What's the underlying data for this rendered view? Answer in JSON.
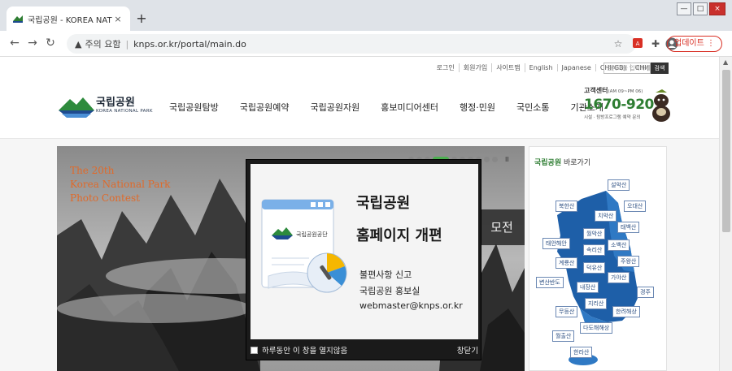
{
  "browser": {
    "tab_title": "국립공원 - KOREA NATIONAL P...",
    "tab_close": "×",
    "new_tab": "+",
    "window_controls": [
      "—",
      "□",
      "×"
    ],
    "security_label": "주의 요함",
    "url": "knps.or.kr/portal/main.do",
    "update_button": "업데이트 ⋮",
    "colors": {
      "tabstrip": "#dfe3e8",
      "update": "#d93025"
    }
  },
  "header": {
    "utility_links": [
      "로그인",
      "회원가입",
      "사이트맵",
      "English",
      "Japanese",
      "CHI(GB)",
      "CHI(BIG)"
    ],
    "search_placeholder": "검색어를 입력하세요",
    "search_button": "검색",
    "logo_ko": "국립공원",
    "logo_en": "KOREA NATIONAL PARK",
    "menu": [
      "국립공원탐방",
      "국립공원예약",
      "국립공원자원",
      "홍보미디어센터",
      "행정·민원",
      "국민소통",
      "기관소개"
    ],
    "customer_center": {
      "title": "고객센터",
      "hours": "AM 09~PM 06",
      "phone": "1670-9201",
      "desc": "시설 · 탐방프로그램 예약 문의"
    }
  },
  "banner": {
    "contest_lines": [
      "The 20th",
      "Korea National Park",
      "Photo Contest"
    ],
    "right_label": "모전",
    "pause_icon": "II"
  },
  "popup": {
    "logo_text": "국립공원공단",
    "title_line1": "국립공원",
    "title_line2": "홈페이지 개편",
    "line1": "불편사항 신고",
    "line2": "국립공원 홍보실",
    "line3": "webmaster@knps.or.kr",
    "dont_show": "하루동안 이 창을 열지않음",
    "close": "창닫기"
  },
  "shortcut": {
    "title_green": "국립공원",
    "title_rest": " 바로가기",
    "parks": [
      "설악산",
      "북한산",
      "오대산",
      "치악산",
      "태백산",
      "태안해안",
      "월악산",
      "소백산",
      "속리산",
      "계룡산",
      "주왕산",
      "덕유산",
      "가야산",
      "변산반도",
      "내장산",
      "경주",
      "지리산",
      "무등산",
      "한려해상",
      "다도해해상",
      "월출산",
      "한라산"
    ]
  }
}
